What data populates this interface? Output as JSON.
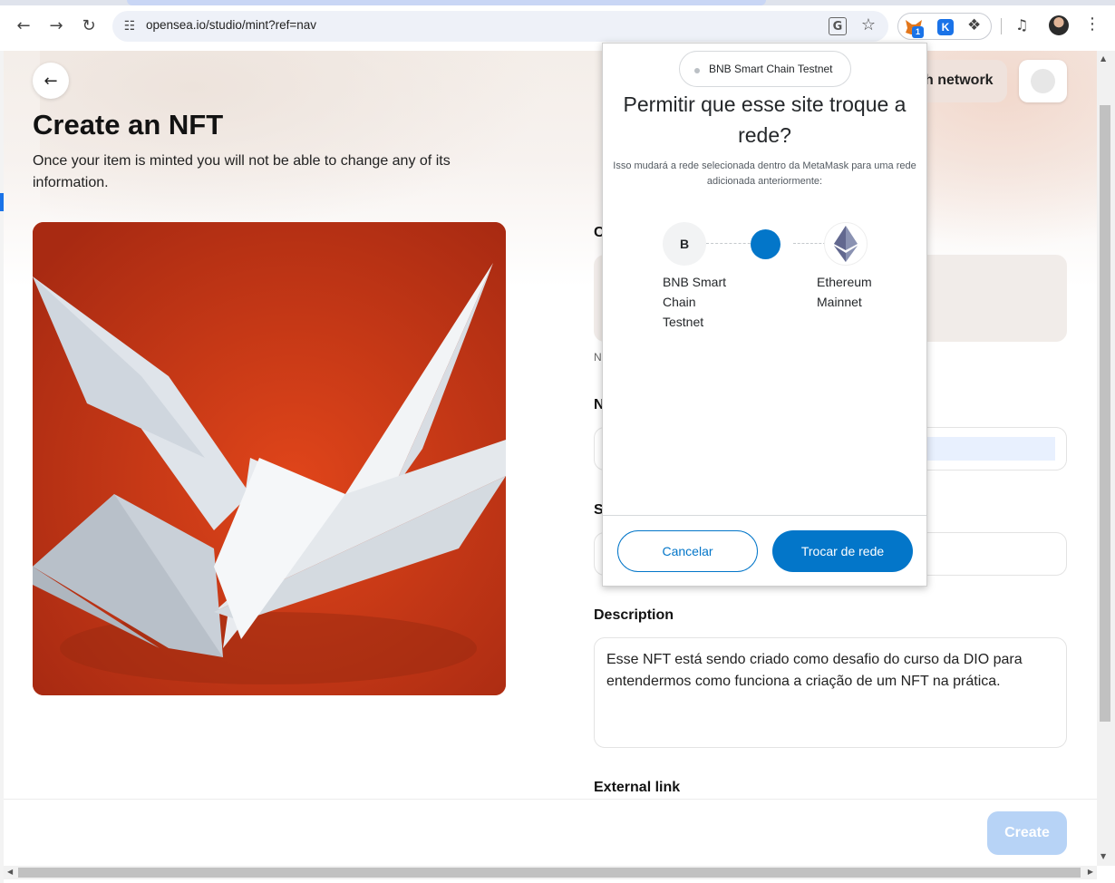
{
  "browser": {
    "url": "opensea.io/studio/mint?ref=nav",
    "extension_badge": "1",
    "extension_k_label": "K"
  },
  "page": {
    "title": "Create an NFT",
    "subtitle": "Once your item is minted you will not be able to change any of its information.",
    "switch_network_label": "h network",
    "collection_label_fragment": "C",
    "collection_hint_fragment": "N",
    "name_label_fragment": "N",
    "supply_label_fragment": "S",
    "description_label": "Description",
    "description_value": "Esse NFT está sendo criado como desafio do curso da DIO para entendermos como funciona a criação de um NFT na prática.",
    "external_link_label": "External link",
    "create_button": "Create"
  },
  "metamask": {
    "current_network": "BNB Smart Chain Testnet",
    "title": "Permitir que esse site troque a rede?",
    "description": "Isso mudará a rede selecionada dentro da MetaMask para uma rede adicionada anteriormente:",
    "from_network_initial": "B",
    "from_network_label": "BNB Smart Chain Testnet",
    "to_network_label": "Ethereum Mainnet",
    "cancel_button": "Cancelar",
    "confirm_button": "Trocar de rede"
  },
  "colors": {
    "metamask_blue": "#0376c9",
    "opensea_create_disabled": "#b7d3f6",
    "nft_background": "#c93a1a"
  },
  "icons": [
    "back-arrow-icon",
    "forward-arrow-icon",
    "reload-icon",
    "site-settings-icon",
    "translate-icon",
    "bookmark-star-icon",
    "metamask-fox-icon",
    "puzzle-extensions-icon",
    "media-control-icon",
    "kebab-menu-icon",
    "ethereum-icon"
  ]
}
